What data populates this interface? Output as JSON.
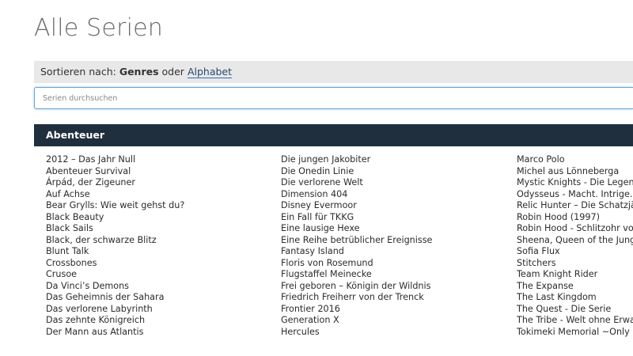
{
  "page": {
    "title": "Alle Serien"
  },
  "sort": {
    "prefix": "Sortieren nach:",
    "option_genres": "Genres",
    "separator": "oder",
    "option_alphabet": "Alphabet"
  },
  "search": {
    "placeholder": "Serien durchsuchen",
    "value": ""
  },
  "genre": {
    "name": "Abenteuer"
  },
  "columns": [
    [
      "2012 – Das Jahr Null",
      "Abenteuer Survival",
      "Árpád, der Zigeuner",
      "Auf Achse",
      "Bear Grylls: Wie weit gehst du?",
      "Black Beauty",
      "Black Sails",
      "Black, der schwarze Blitz",
      "Blunt Talk",
      "Crossbones",
      "Crusoe",
      "Da Vinci’s Demons",
      "Das Geheimnis der Sahara",
      "Das verlorene Labyrinth",
      "Das zehnte Königreich",
      "Der Mann aus Atlantis"
    ],
    [
      "Die jungen Jakobiter",
      "Die Onedin Linie",
      "Die verlorene Welt",
      "Dimension 404",
      "Disney Evermoor",
      "Ein Fall für TKKG",
      "Eine lausige Hexe",
      "Eine Reihe betrüblicher Ereignisse",
      "Fantasy Island",
      "Floris von Rosemund",
      "Flugstaffel Meinecke",
      "Frei geboren – Königin der Wildnis",
      "Friedrich Freiherr von der Trenck",
      "Frontier 2016",
      "Generation X",
      "Hercules"
    ],
    [
      "Marco Polo",
      "Michel aus Lönneberga",
      "Mystic Knights - Die Legende",
      "Odysseus - Macht. Intrige. M",
      "Relic Hunter – Die Schatzjäg",
      "Robin Hood (1997)",
      "Robin Hood - Schlitzohr von",
      "Sheena, Queen of the Jungle",
      "Sofia Flux",
      "Stitchers",
      "Team Knight Rider",
      "The Expanse",
      "The Last Kingdom",
      "The Quest - Die Serie",
      "The Tribe - Welt ohne Erwac",
      "Tokimeki Memorial ~Only Lo"
    ]
  ],
  "colors": {
    "title": "#6b6b6b",
    "sort_bar_bg": "#e8e8e8",
    "genre_header_bg": "#1f2f3d",
    "link_underline": "#2a6ebb",
    "input_focus_border": "#66a3d2"
  }
}
